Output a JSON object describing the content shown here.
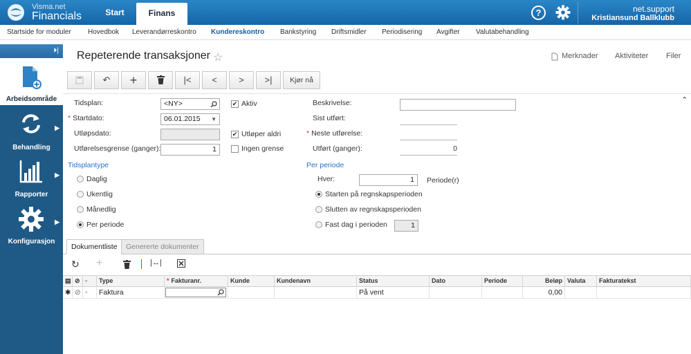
{
  "header": {
    "brand_top": "Visma.net",
    "brand_main": "Financials",
    "tabs": [
      "Start",
      "Finans"
    ],
    "user_name": "net.support",
    "company": "Kristiansund Ballklubb"
  },
  "modules": [
    "Startside for moduler",
    "Hovedbok",
    "Leverandørreskontro",
    "Kundereskontro",
    "Bankstyring",
    "Driftsmidler",
    "Periodisering",
    "Avgifter",
    "Valutabehandling"
  ],
  "sidebar": {
    "items": [
      {
        "label": "Arbeidsområde"
      },
      {
        "label": "Behandling"
      },
      {
        "label": "Rapporter"
      },
      {
        "label": "Konfigurasjon"
      }
    ]
  },
  "page": {
    "title": "Repeterende transaksjoner",
    "actions": [
      "Merknader",
      "Aktiviteter",
      "Filer"
    ],
    "run_button": "Kjør nå"
  },
  "form": {
    "tidsplan_label": "Tidsplan:",
    "tidsplan_value": "<NY>",
    "startdato_label": "Startdato:",
    "startdato_value": "06.01.2015",
    "utlopsdato_label": "Utløpsdato:",
    "grense_label": "Utførelsesgrense (ganger):",
    "grense_value": "1",
    "aktiv_label": "Aktiv",
    "utloper_label": "Utløper aldri",
    "ingen_grense_label": "Ingen grense",
    "beskrivelse_label": "Beskrivelse:",
    "sist_utfort_label": "Sist utført:",
    "neste_label": "Neste utførelse:",
    "utfort_label": "Utført (ganger):",
    "utfort_value": "0",
    "tidsplantype_label": "Tidsplantype",
    "tidsplantyper": [
      "Daglig",
      "Ukentlig",
      "Månedlig",
      "Per periode"
    ],
    "per_periode_label": "Per periode",
    "hver_label": "Hver:",
    "hver_value": "1",
    "perioder_label": "Periode(r)",
    "periode_options": [
      "Starten på regnskapsperioden",
      "Slutten av regnskapsperioden",
      "Fast dag i perioden"
    ],
    "fast_dag_value": "1"
  },
  "tabs": [
    "Dokumentliste",
    "Genererte dokumenter"
  ],
  "grid": {
    "columns": [
      "Type",
      "Fakturanr.",
      "Kunde",
      "Kundenavn",
      "Status",
      "Dato",
      "Periode",
      "Beløp",
      "Valuta",
      "Fakturatekst"
    ],
    "row": {
      "type": "Faktura",
      "status": "På vent",
      "belop": "0,00"
    }
  }
}
